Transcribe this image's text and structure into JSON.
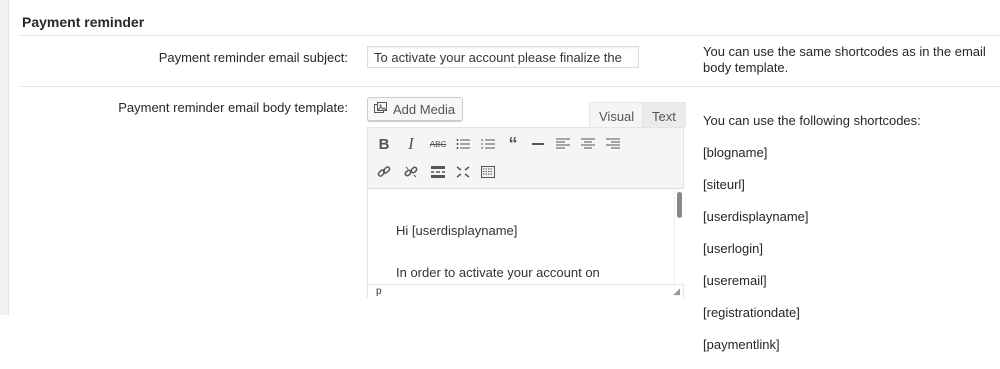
{
  "section": {
    "title": "Payment reminder"
  },
  "subject_row": {
    "label": "Payment reminder email subject:",
    "input_value": "To activate your account please finalize the",
    "help": "You can use the same shortcodes as in the email\nbody template."
  },
  "body_row": {
    "label": "Payment reminder email body template:",
    "add_media_label": "Add Media",
    "tabs": {
      "visual": "Visual",
      "text": "Text"
    },
    "toolbar_row1": [
      "bold-icon",
      "italic-icon",
      "strikethrough-icon",
      "bullet-list-icon",
      "numbered-list-icon",
      "blockquote-icon",
      "horizontal-rule-icon",
      "align-left-icon",
      "align-center-icon",
      "align-right-icon"
    ],
    "toolbar_row2": [
      "link-icon",
      "unlink-icon",
      "read-more-icon",
      "fullscreen-icon",
      "toolbar-toggle-icon"
    ],
    "content_lines": [
      "Hi [userdisplayname]",
      "In order to activate your account on"
    ],
    "status_path": "p",
    "help_title": "You can use the following shortcodes:",
    "shortcodes": [
      "[blogname]",
      "[siteurl]",
      "[userdisplayname]",
      "[userlogin]",
      "[useremail]",
      "[registrationdate]",
      "[paymentlink]"
    ]
  }
}
